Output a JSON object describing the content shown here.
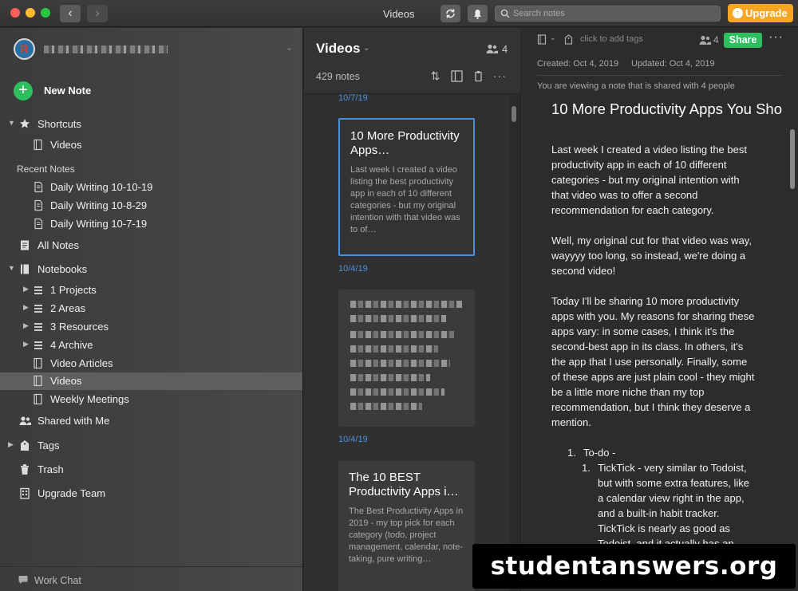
{
  "window": {
    "title": "Videos",
    "search_placeholder": "Search notes",
    "upgrade_label": "Upgrade"
  },
  "sidebar": {
    "new_note_label": "New Note",
    "shortcuts_label": "Shortcuts",
    "shortcut_items": [
      "Videos"
    ],
    "recent_notes_label": "Recent Notes",
    "recent_items": [
      "Daily Writing 10-10-19",
      "Daily Writing 10-8-29",
      "Daily Writing 10-7-19"
    ],
    "all_notes_label": "All Notes",
    "notebooks_label": "Notebooks",
    "notebook_stacks": [
      "1 Projects",
      "2 Areas",
      "3 Resources",
      "4 Archive"
    ],
    "notebooks": [
      "Video Articles",
      "Videos",
      "Weekly Meetings"
    ],
    "selected_notebook": "Videos",
    "shared_label": "Shared with Me",
    "tags_label": "Tags",
    "trash_label": "Trash",
    "upgrade_team_label": "Upgrade Team",
    "work_chat_label": "Work Chat"
  },
  "note_list": {
    "title": "Videos",
    "share_count": "4",
    "note_count": "429 notes",
    "top_date": "10/7/19",
    "cards": [
      {
        "title": "10 More Productivity Apps…",
        "snippet": "Last week I created a video listing the best productivity app in each of 10 different categories - but my original intention with that video was to of…",
        "date_after": "10/4/19"
      },
      {
        "title": "",
        "snippet": "",
        "date_after": "10/4/19"
      },
      {
        "title": "The 10 BEST Productivity Apps i…",
        "snippet": "The Best Productivity Apps in 2019 - my top pick for each category (todo, project management, calendar, note-taking, pure writing…",
        "date_after": ""
      }
    ]
  },
  "editor": {
    "tag_placeholder": "click to add tags",
    "share_count": "4",
    "share_label": "Share",
    "more_label": "···",
    "created": "Created: Oct 4, 2019",
    "updated": "Updated: Oct 4, 2019",
    "shared_notice": "You are viewing a note that is shared with 4 people",
    "title": "10 More Productivity Apps You Sho",
    "paragraphs": [
      "Last week I created a video listing the best productivity app in each of 10 different categories - but my original intention with that video was to offer a second recommendation for each category.",
      "Well, my original cut for that video was way, wayyyy too long, so instead, we're doing a second video!",
      "Today I'll be sharing 10 more productivity apps with you. My reasons for sharing these apps vary: in some cases, I think it's the second-best app in its class. In others, it's the app that I use personally. Finally, some of these apps are just plain cool - they might be a little more niche than my top recommendation, but I think they deserve a mention."
    ],
    "list_item_1_num": "1.",
    "list_item_1": "To-do -",
    "list_sub_1_num": "1.",
    "list_sub_1": "TickTick - very similar to Todoist, but with some extra features, like a calendar view right in the app, and a built-in habit tracker. TickTick is nearly as good as Todoist, and it actually has an edge over me since their natural language processing is a bit"
  },
  "watermark": "studentanswers.org",
  "colors": {
    "accent_green": "#2dbe60",
    "upgrade_orange": "#f6a623",
    "date_blue": "#4a90e2"
  }
}
